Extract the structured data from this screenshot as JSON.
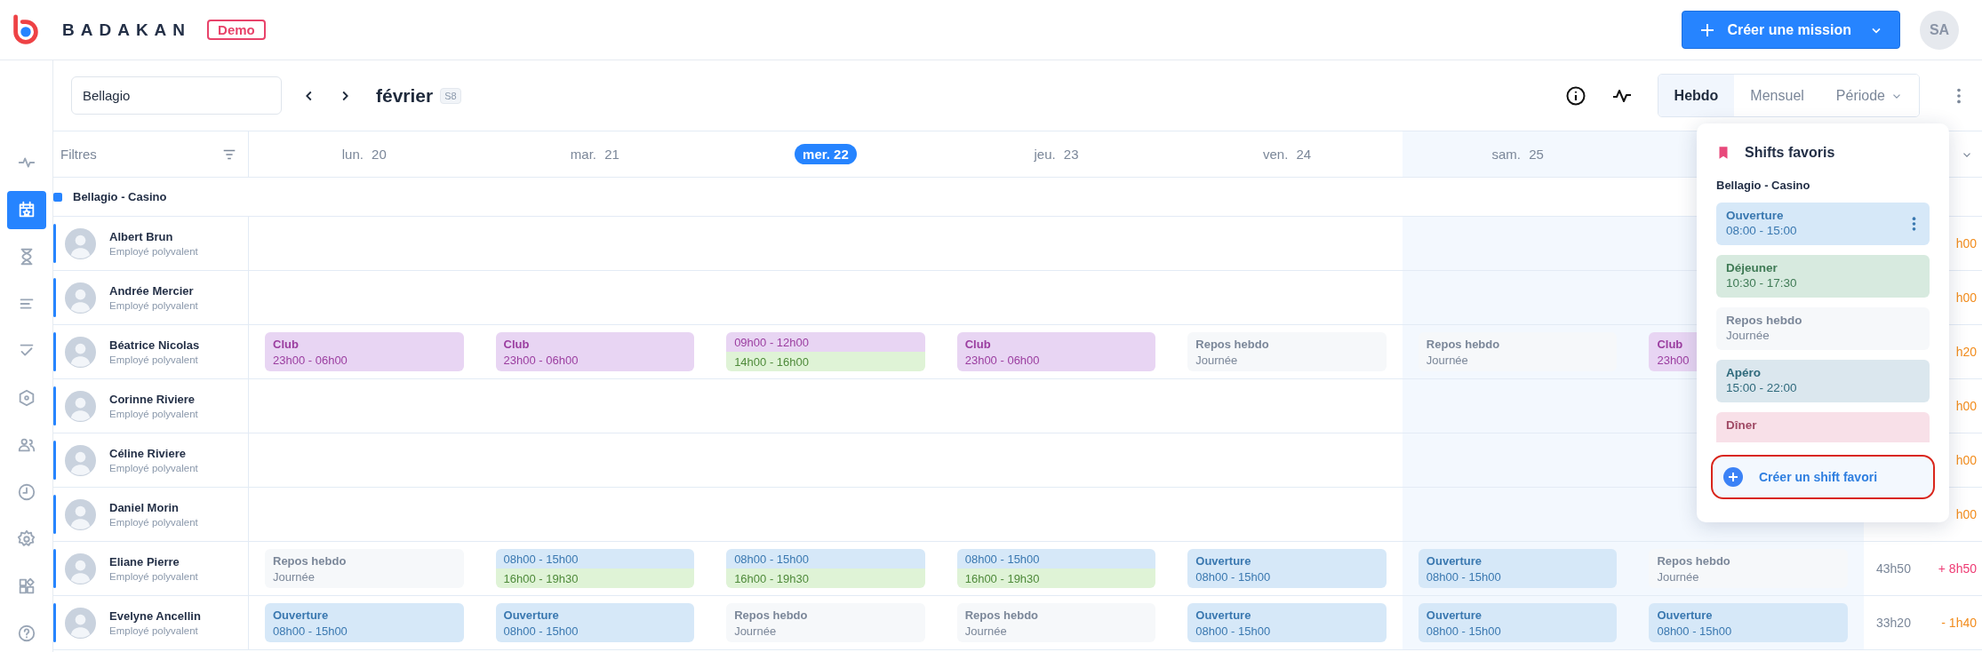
{
  "topbar": {
    "brand": "BADAKAN",
    "badge": "Demo",
    "create_button": "Créer une mission",
    "avatar": "SA"
  },
  "sidebar": {
    "items": [
      {
        "selected": false
      },
      {
        "selected": true
      },
      {
        "selected": false
      },
      {
        "selected": false
      },
      {
        "selected": false
      },
      {
        "selected": false
      },
      {
        "selected": false
      },
      {
        "selected": false
      },
      {
        "selected": false
      },
      {
        "selected": false
      },
      {
        "selected": false
      }
    ]
  },
  "toolbar": {
    "search": {
      "value": "Bellagio"
    },
    "month": "février",
    "week": "S8",
    "views": [
      {
        "label": "Hebdo",
        "selected": true,
        "dropdown": false
      },
      {
        "label": "Mensuel",
        "selected": false,
        "dropdown": false
      },
      {
        "label": "Période",
        "selected": false,
        "dropdown": true
      }
    ]
  },
  "table": {
    "filter_label": "Filtres",
    "days": [
      {
        "label": "lun. 20",
        "selected": false,
        "weekend": false
      },
      {
        "label": "mar. 21",
        "selected": false,
        "weekend": false
      },
      {
        "label": "mer. 22",
        "selected": true,
        "weekend": false
      },
      {
        "label": "jeu. 23",
        "selected": false,
        "weekend": false
      },
      {
        "label": "ven. 24",
        "selected": false,
        "weekend": false
      },
      {
        "label": "sam. 25",
        "selected": false,
        "weekend": true
      },
      {
        "weekend": true
      }
    ],
    "group": "Bellagio - Casino",
    "rows": [
      {
        "name": "Albert Brun",
        "role": "Employé polyvalent",
        "cells": [
          [],
          [],
          [],
          [],
          [],
          [],
          []
        ],
        "total": {
          "diff": "h00",
          "color": "#f28c1c"
        }
      },
      {
        "name": "Andrée Mercier",
        "role": "Employé polyvalent",
        "cells": [
          [],
          [],
          [],
          [],
          [],
          [],
          []
        ],
        "total": {
          "diff": "h00",
          "color": "#f28c1c"
        }
      },
      {
        "name": "Béatrice Nicolas",
        "role": "Employé polyvalent",
        "cells": [
          [
            {
              "kind": "club",
              "title": "Club",
              "time": "23h00 - 06h00"
            }
          ],
          [
            {
              "kind": "club",
              "title": "Club",
              "time": "23h00 - 06h00"
            }
          ],
          [
            {
              "kind": "club",
              "time": "09h00 - 12h00"
            },
            {
              "kind": "afternoon",
              "time": "14h00 - 16h00"
            }
          ],
          [
            {
              "kind": "club",
              "title": "Club",
              "time": "23h00 - 06h00"
            }
          ],
          [
            {
              "kind": "rest",
              "title": "Repos hebdo",
              "time": "Journée"
            }
          ],
          [
            {
              "kind": "rest",
              "title": "Repos hebdo",
              "time": "Journée"
            }
          ],
          [
            {
              "kind": "club",
              "title": "Club",
              "time": "23h00"
            }
          ]
        ],
        "total": {
          "diff": "h20",
          "color": "#f28c1c"
        }
      },
      {
        "name": "Corinne Riviere",
        "role": "Employé polyvalent",
        "cells": [
          [],
          [],
          [],
          [],
          [],
          [],
          []
        ],
        "total": {
          "diff": "h00",
          "color": "#f28c1c"
        }
      },
      {
        "name": "Céline Riviere",
        "role": "Employé polyvalent",
        "cells": [
          [],
          [],
          [],
          [],
          [],
          [],
          []
        ],
        "total": {
          "diff": "h00",
          "color": "#f28c1c"
        }
      },
      {
        "name": "Daniel Morin",
        "role": "Employé polyvalent",
        "cells": [
          [],
          [],
          [],
          [],
          [],
          [],
          []
        ],
        "total": {
          "diff": "h00",
          "color": "#f28c1c"
        }
      },
      {
        "name": "Eliane Pierre",
        "role": "Employé polyvalent",
        "cells": [
          [
            {
              "kind": "rest",
              "title": "Repos hebdo",
              "time": "Journée"
            }
          ],
          [
            {
              "kind": "open",
              "time": "08h00 - 15h00"
            },
            {
              "kind": "afternoon",
              "time": "16h00 - 19h30"
            }
          ],
          [
            {
              "kind": "open",
              "time": "08h00 - 15h00"
            },
            {
              "kind": "afternoon",
              "time": "16h00 - 19h30"
            }
          ],
          [
            {
              "kind": "open",
              "time": "08h00 - 15h00"
            },
            {
              "kind": "afternoon",
              "time": "16h00 - 19h30"
            }
          ],
          [
            {
              "kind": "open",
              "title": "Ouverture",
              "time": "08h00 - 15h00"
            }
          ],
          [
            {
              "kind": "open",
              "title": "Ouverture",
              "time": "08h00 - 15h00"
            }
          ],
          [
            {
              "kind": "rest",
              "title": "Repos hebdo",
              "time": "Journée"
            }
          ]
        ],
        "total": {
          "hours": "43h50",
          "diff": "+ 8h50",
          "color": "#ee3a73"
        }
      },
      {
        "name": "Evelyne Ancellin",
        "role": "Employé polyvalent",
        "cells": [
          [
            {
              "kind": "open",
              "title": "Ouverture",
              "time": "08h00 - 15h00"
            }
          ],
          [
            {
              "kind": "open",
              "title": "Ouverture",
              "time": "08h00 - 15h00"
            }
          ],
          [
            {
              "kind": "rest",
              "title": "Repos hebdo",
              "time": "Journée"
            }
          ],
          [
            {
              "kind": "rest",
              "title": "Repos hebdo",
              "time": "Journée"
            }
          ],
          [
            {
              "kind": "open",
              "title": "Ouverture",
              "time": "08h00 - 15h00"
            }
          ],
          [
            {
              "kind": "open",
              "title": "Ouverture",
              "time": "08h00 - 15h00"
            }
          ],
          [
            {
              "kind": "open",
              "title": "Ouverture",
              "time": "08h00 - 15h00"
            }
          ]
        ],
        "total": {
          "hours": "33h20",
          "diff": "- 1h40",
          "color": "#f28c1c"
        }
      }
    ]
  },
  "favorites": {
    "title": "Shifts favoris",
    "group": "Bellagio - Casino",
    "items": [
      {
        "kind": "open",
        "title": "Ouverture",
        "time": "08:00 - 15:00",
        "hovered": true
      },
      {
        "kind": "lunch",
        "title": "Déjeuner",
        "time": "10:30 - 17:30",
        "hovered": false
      },
      {
        "kind": "rest",
        "title": "Repos hebdo",
        "time": "Journée",
        "hovered": false
      },
      {
        "kind": "aperitif",
        "title": "Apéro",
        "time": "15:00 - 22:00",
        "hovered": false
      },
      {
        "kind": "dinner",
        "title": "Dîner",
        "hovered": false
      }
    ],
    "create_button": {
      "label": "Créer un shift favori",
      "highlighted": true
    }
  }
}
